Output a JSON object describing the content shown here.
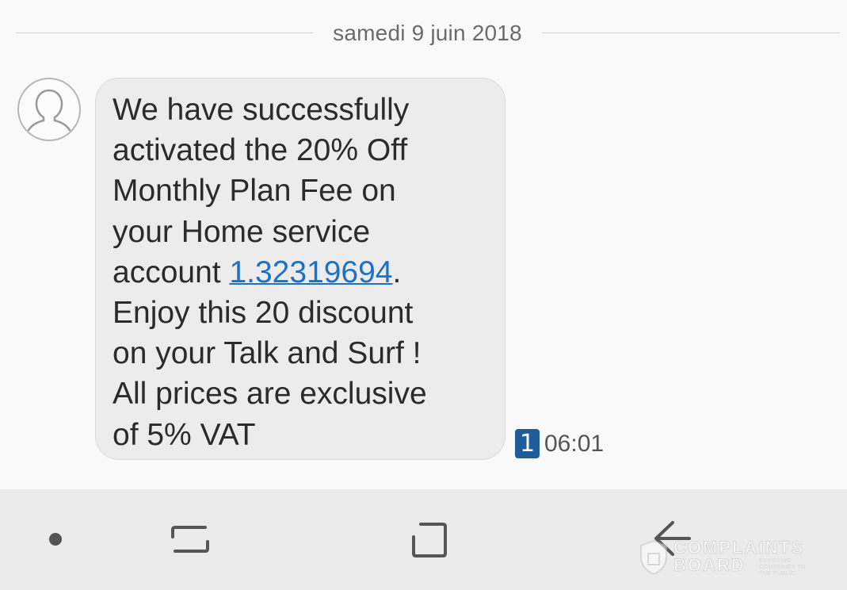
{
  "conversation": {
    "date_separator": "samedi 9 juin 2018"
  },
  "message": {
    "text_before_link": "We have successfully\nactivated the 20% Off\nMonthly Plan Fee on\nyour Home service\naccount ",
    "link_text": "1.32319694",
    "text_after_link": ".\nEnjoy this 20 discount\non your Talk and Surf !\nAll prices are exclusive\nof 5% VAT",
    "sim_slot": "1",
    "time": "06:01"
  },
  "avatar": {
    "icon": "person-outline-icon"
  },
  "navbar": {
    "dot_icon": "dot-icon",
    "recent_icon": "recent-apps-icon",
    "home_icon": "home-square-icon",
    "back_icon": "back-arrow-icon"
  },
  "watermark": {
    "line1": "COMPLAINTS",
    "line2": "BOARD",
    "tagline": "EXPOSING COMPANIES TO THE PUBLIC"
  },
  "colors": {
    "background": "#f9f9f9",
    "bubble": "#ececec",
    "link": "#1a73c8",
    "sim_badge": "#1f5c99",
    "navbar": "#ebebeb"
  }
}
